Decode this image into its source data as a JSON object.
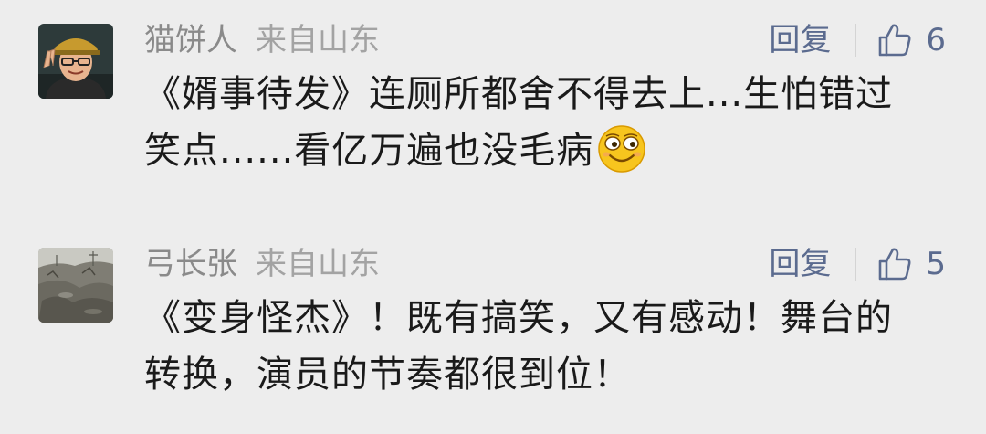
{
  "comments": [
    {
      "author": "猫饼人",
      "location": "来自山东",
      "reply_label": "回复",
      "like_count": "6",
      "content_line1": "《婿事待发》连厕所都舍不得去上...生怕错过",
      "content_line2": "笑点......看亿万遍也没毛病",
      "emoji": "grinning-squint-emoji",
      "avatar_icon": "person-with-cap-avatar"
    },
    {
      "author": "弓长张",
      "location": "来自山东",
      "reply_label": "回复",
      "like_count": "5",
      "content_line1": "《变身怪杰》！既有搞笑，又有感动！舞台的",
      "content_line2": "转换，演员的节奏都很到位！",
      "avatar_icon": "rocky-landscape-avatar"
    }
  ],
  "icons": {
    "like": "thumbs-up-icon"
  },
  "colors": {
    "background": "#ededed",
    "name_gray": "#8a8a8a",
    "action_blue": "#5b6b8f",
    "text": "#1a1a1a"
  }
}
